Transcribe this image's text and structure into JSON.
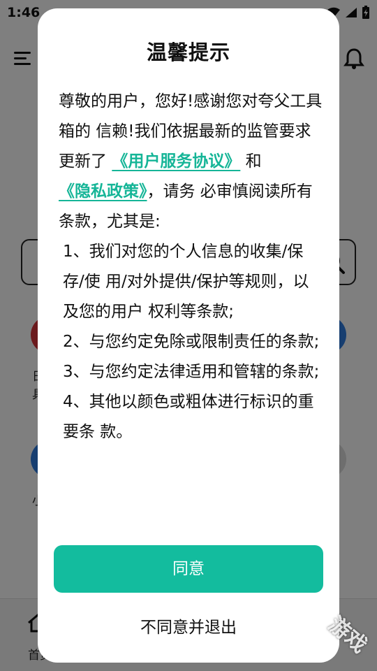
{
  "status_bar": {
    "time": "1:46",
    "icons": [
      "wifi-icon",
      "signal-icon",
      "battery-charging-icon"
    ]
  },
  "app": {
    "header_icons": [
      "menu-icon",
      "bell-icon"
    ],
    "tools_row1_labels": [
      "日",
      "具"
    ],
    "tools_row2_labels": [
      "小"
    ],
    "bottom_nav": {
      "home_label": "首页"
    }
  },
  "dialog": {
    "title": "温馨提示",
    "intro_1": "尊敬的用户，您好!感谢您对夸父工具箱的 信赖!我们依据最新的监管要求更新了",
    "link_user_agreement": "《用户服务协议》",
    "and": "和",
    "link_privacy": "《隐私政策》",
    "intro_2": "，请务 必审慎阅读所有条款，尤其是:",
    "items": [
      "1、我们对您的个人信息的收集/保存/使 用/对外提供/保护等规则，以及您的用户 权利等条款;",
      "2、与您约定免除或限制责任的条款;",
      "3、与您约定法律适用和管辖的条款;",
      "4、其他以颜色或粗体进行标识的重要条 款。"
    ],
    "agree_label": "同意",
    "disagree_label": "不同意并退出"
  },
  "watermark": "游戏",
  "colors": {
    "accent": "#13bc9e",
    "link": "#15b597",
    "overlay": "rgba(0,0,0,0.5)",
    "tool_red": "#d6343a",
    "tool_blue": "#2f7de0"
  }
}
